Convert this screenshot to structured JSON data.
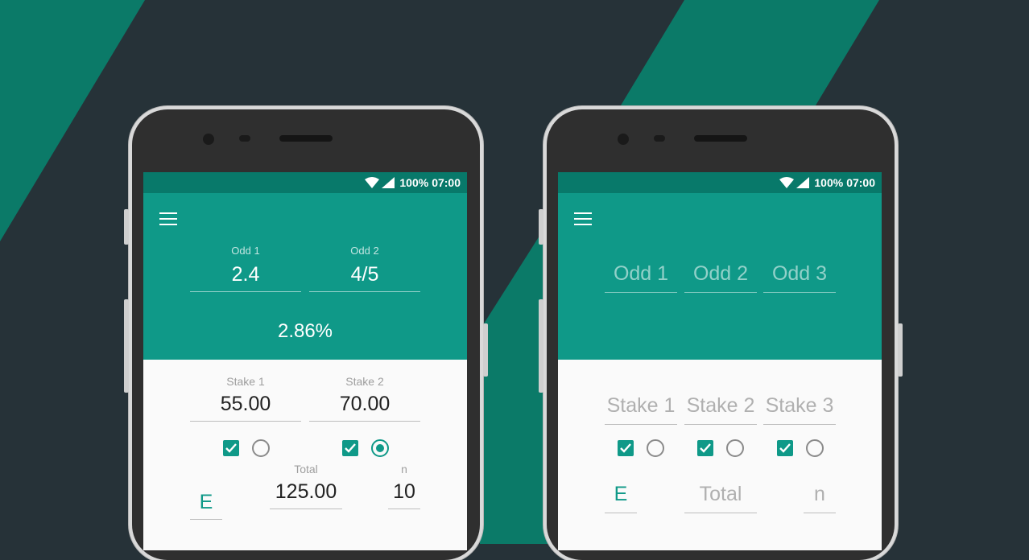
{
  "colors": {
    "background": "#263238",
    "stripe": "#0b7a68",
    "primary": "#0f9988",
    "status_bar": "#08796a"
  },
  "left_phone": {
    "status": {
      "battery": "100%",
      "time": "07:00",
      "icons": [
        "wifi-icon",
        "signal-icon"
      ]
    },
    "odds": [
      {
        "label": "Odd 1",
        "value": "2.4"
      },
      {
        "label": "Odd 2",
        "value": "4/5"
      }
    ],
    "percentage": "2.86%",
    "stakes": [
      {
        "label": "Stake 1",
        "value": "55.00",
        "checked": true,
        "radio_selected": false
      },
      {
        "label": "Stake 2",
        "value": "70.00",
        "checked": true,
        "radio_selected": true
      }
    ],
    "mode": "E",
    "total": {
      "label": "Total",
      "value": "125.00"
    },
    "n": {
      "label": "n",
      "value": "10"
    }
  },
  "right_phone": {
    "status": {
      "battery": "100%",
      "time": "07:00",
      "icons": [
        "wifi-icon",
        "signal-icon"
      ]
    },
    "odd_placeholders": [
      "Odd 1",
      "Odd 2",
      "Odd 3"
    ],
    "stake_placeholders": [
      "Stake 1",
      "Stake 2",
      "Stake 3"
    ],
    "mode": "E",
    "total_placeholder": "Total",
    "n_placeholder": "n"
  }
}
